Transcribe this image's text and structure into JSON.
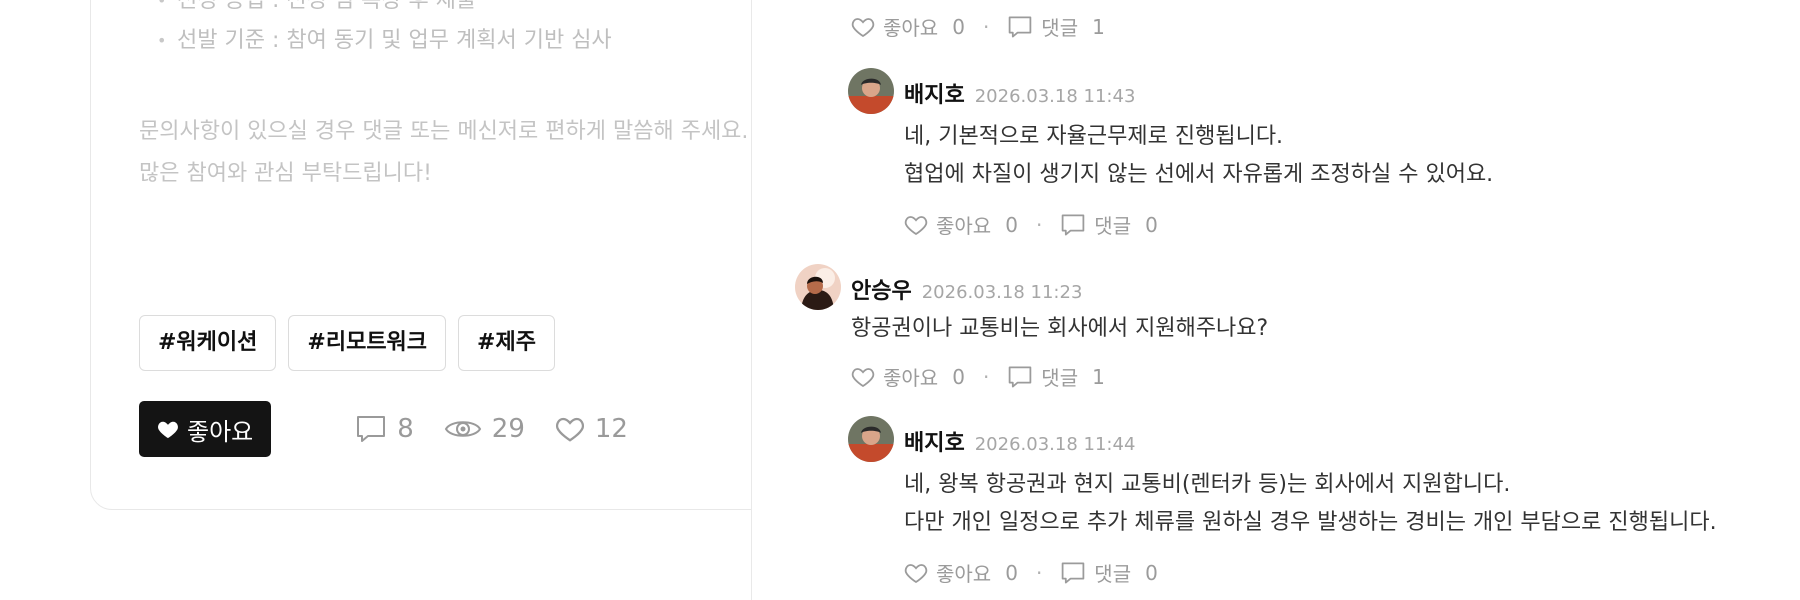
{
  "post": {
    "bullets": [
      "선정 공법 : 선정 팀 복장 후 제출",
      "선발 기준 : 참여 동기 및 업무 계획서 기반 심사"
    ],
    "paragraph": [
      "문의사항이 있으실 경우 댓글 또는 메신저로 편하게 말씀해 주세요.",
      "많은 참여와 관심 부탁드립니다!"
    ],
    "tags": [
      "#워케이션",
      "#리모트워크",
      "#제주"
    ],
    "like_button": "좋아요",
    "stats": {
      "comments": "8",
      "views": "29",
      "likes": "12"
    }
  },
  "comments": {
    "like_label": "좋아요",
    "reply_label": "댓글",
    "items": [
      {
        "meta": {
          "likes": "0",
          "replies": "1"
        }
      },
      {
        "author": "배지호",
        "time": "2026.03.18 11:43",
        "lines": [
          "네, 기본적으로 자율근무제로 진행됩니다.",
          "협업에 차질이 생기지 않는 선에서 자유롭게 조정하실 수 있어요."
        ],
        "meta": {
          "likes": "0",
          "replies": "0"
        }
      },
      {
        "author": "안승우",
        "time": "2026.03.18 11:23",
        "lines": [
          "항공권이나 교통비는 회사에서 지원해주나요?"
        ],
        "meta": {
          "likes": "0",
          "replies": "1"
        }
      },
      {
        "author": "배지호",
        "time": "2026.03.18 11:44",
        "lines": [
          "네, 왕복 항공권과 현지 교통비(렌터카 등)는 회사에서 지원합니다.",
          "다만 개인 일정으로 추가 체류를 원하실 경우 발생하는 경비는 개인 부담으로 진행됩니다."
        ],
        "meta": {
          "likes": "0",
          "replies": "0"
        }
      }
    ]
  },
  "colors": {
    "accent": "#141414",
    "muted": "#9b9b9b",
    "border": "#e8e8e8"
  }
}
